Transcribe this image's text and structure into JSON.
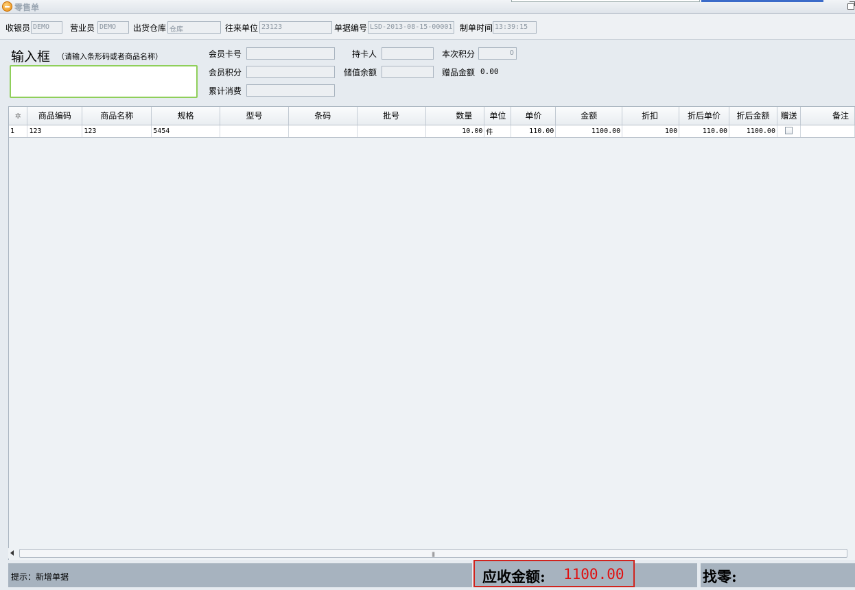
{
  "window": {
    "title": "零售单"
  },
  "header": {
    "cashier_label": "收银员",
    "cashier_value": "DEMO",
    "salesperson_label": "营业员",
    "salesperson_value": "DEMO",
    "warehouse_label": "出货仓库",
    "warehouse_value": "仓库",
    "partner_label": "往来单位",
    "partner_value": "23123",
    "doc_no_label": "单据编号",
    "doc_no_value": "LSD-2013-08-15-00001",
    "created_time_label": "制单时间",
    "created_time_value": "13:39:15"
  },
  "input": {
    "title": "输入框",
    "hint": "（请输入条形码或者商品名称）",
    "value": ""
  },
  "member": {
    "card_no_label": "会员卡号",
    "card_no_value": "",
    "holder_label": "持卡人",
    "holder_value": "",
    "this_points_label": "本次积分",
    "this_points_value": "0",
    "points_label": "会员积分",
    "points_value": "",
    "balance_label": "储值余额",
    "balance_value": "",
    "gift_amount_label": "赠品金额",
    "gift_amount_value": "0.00",
    "total_spent_label": "累计消费",
    "total_spent_value": ""
  },
  "table": {
    "corner_marker": "✲",
    "columns": [
      "商品编码",
      "商品名称",
      "规格",
      "型号",
      "条码",
      "批号",
      "数量",
      "单位",
      "单价",
      "金额",
      "折扣",
      "折后单价",
      "折后金额",
      "赠送",
      "备注"
    ],
    "rows": [
      {
        "row_no": "1",
        "code": "123",
        "name": "123",
        "spec": "5454",
        "model": "",
        "barcode": "",
        "batch": "",
        "qty": "10.00",
        "unit": "件",
        "unit_price": "110.00",
        "amount": "1100.00",
        "discount": "100",
        "disc_unit_price": "110.00",
        "disc_amount": "1100.00",
        "gift": false,
        "remark": ""
      }
    ]
  },
  "footer": {
    "hint": "提示：新增单据",
    "due_label": "应收金额:",
    "due_value": "1100.00",
    "change_label": "找零:",
    "change_value": ""
  }
}
